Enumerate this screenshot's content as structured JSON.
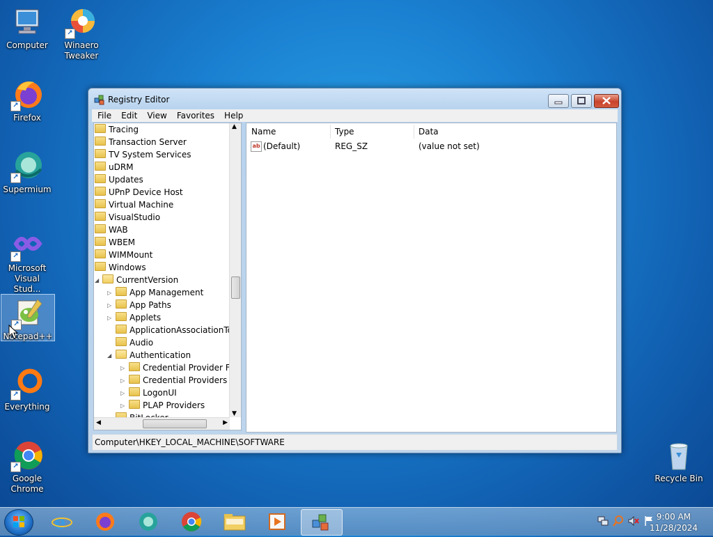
{
  "desktop": {
    "icons": [
      {
        "label": "Computer"
      },
      {
        "label": "Winaero\nTweaker"
      },
      {
        "label": "Firefox"
      },
      {
        "label": "Supermium"
      },
      {
        "label": "Microsoft\nVisual Stud..."
      },
      {
        "label": "Notepad++"
      },
      {
        "label": "Everything"
      },
      {
        "label": "Google\nChrome"
      },
      {
        "label": "Recycle Bin"
      }
    ]
  },
  "window": {
    "title": "Registry Editor",
    "menu": [
      "File",
      "Edit",
      "View",
      "Favorites",
      "Help"
    ],
    "tree": [
      "Tracing",
      "Transaction Server",
      "TV System Services",
      "uDRM",
      "Updates",
      "UPnP Device Host",
      "Virtual Machine",
      "VisualStudio",
      "WAB",
      "WBEM",
      "WIMMount",
      "Windows",
      "CurrentVersion",
      "App Management",
      "App Paths",
      "Applets",
      "ApplicationAssociationToa",
      "Audio",
      "Authentication",
      "Credential Provider Filte",
      "Credential Providers",
      "LogonUI",
      "PLAP Providers",
      "BitLocker"
    ],
    "columns": {
      "name": "Name",
      "type": "Type",
      "data": "Data"
    },
    "values": [
      {
        "name": "(Default)",
        "type": "REG_SZ",
        "data": "(value not set)"
      }
    ],
    "status": "Computer\\HKEY_LOCAL_MACHINE\\SOFTWARE"
  },
  "taskbar": {
    "clock_time": "9:00 AM",
    "clock_date": "11/28/2024"
  }
}
